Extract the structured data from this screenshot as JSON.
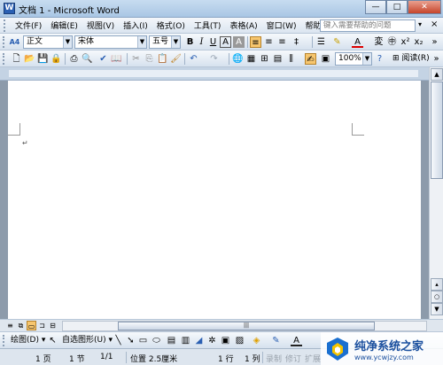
{
  "window": {
    "title": "文档 1 - Microsoft Word",
    "app_icon_letter": "W",
    "minimize": "—",
    "maximize": "□",
    "close": "✕"
  },
  "menubar": {
    "items": [
      "文件(F)",
      "编辑(E)",
      "视图(V)",
      "插入(I)",
      "格式(O)",
      "工具(T)",
      "表格(A)",
      "窗口(W)",
      "帮助(H)"
    ],
    "help_placeholder": "键入需要帮助的问题",
    "help_arrow": "▾",
    "doc_close": "×"
  },
  "formatting": {
    "style_icon": "A4",
    "style": "正文",
    "font": "宋体",
    "size": "五号",
    "bold": "B",
    "italic": "I",
    "underline": "U",
    "char_border": "A",
    "char_shading": "A"
  },
  "standard": {
    "zoom": "100%",
    "read_label": "阅读(R)"
  },
  "drawing": {
    "draw_label": "绘图(D)",
    "autoshape_label": "自选图形(U)"
  },
  "statusbar": {
    "page": "1 页",
    "section": "1 节",
    "page_of": "1/1",
    "position": "位置 2.5厘米",
    "line": "1 行",
    "column": "1 列",
    "rec": "录制",
    "trk": "修订",
    "ext": "扩展"
  },
  "watermark": {
    "main": "纯净系统之家",
    "url": "www.ycwjzy.com"
  },
  "colors": {
    "title_bar": "#a9c6e4",
    "accent_active": "#f7c66e",
    "doc_bg": "#8d9bab",
    "watermark_text": "#1a4f9e"
  }
}
